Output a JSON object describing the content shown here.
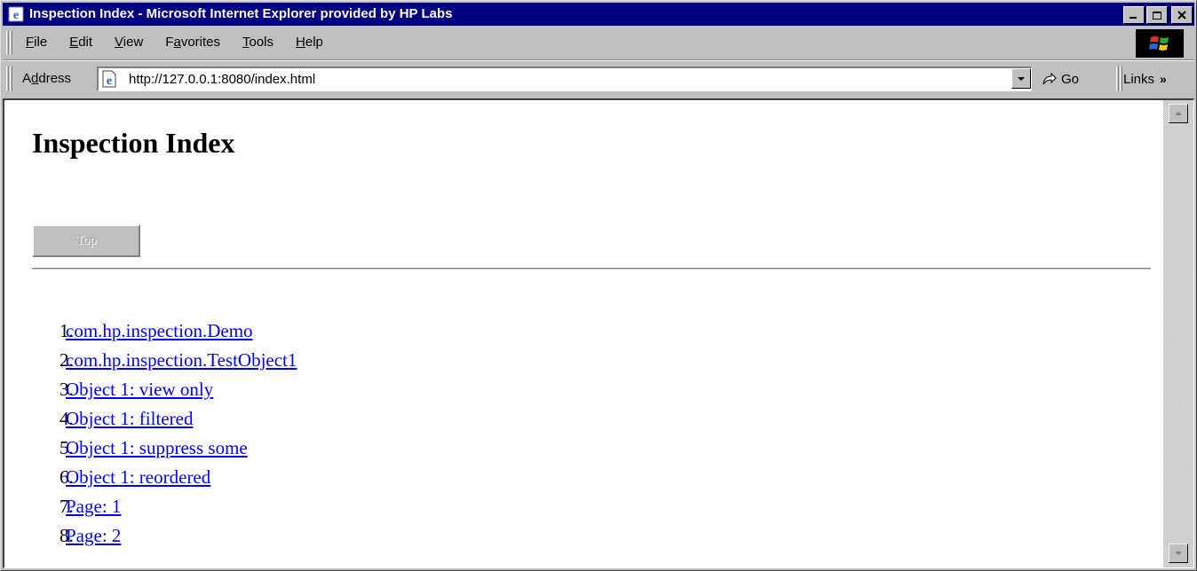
{
  "window": {
    "title": "Inspection Index - Microsoft Internet Explorer provided by HP Labs",
    "title_bar_color": "#000080"
  },
  "menubar": {
    "items": [
      {
        "prefix": "",
        "accel": "F",
        "rest": "ile"
      },
      {
        "prefix": "",
        "accel": "E",
        "rest": "dit"
      },
      {
        "prefix": "",
        "accel": "V",
        "rest": "iew"
      },
      {
        "prefix": "F",
        "accel": "a",
        "rest": "vorites"
      },
      {
        "prefix": "",
        "accel": "T",
        "rest": "ools"
      },
      {
        "prefix": "",
        "accel": "H",
        "rest": "elp"
      }
    ]
  },
  "addressbar": {
    "label_prefix": "A",
    "label_accel": "d",
    "label_rest": "dress",
    "url": "http://127.0.0.1:8080/index.html",
    "go_label": "Go",
    "links_label": "Links"
  },
  "page": {
    "heading": "Inspection Index",
    "top_button": "Top",
    "link_color": "#0000ff",
    "links": [
      {
        "num": "1.",
        "text": "com.hp.inspection.Demo"
      },
      {
        "num": "2.",
        "text": "com.hp.inspection.TestObject1"
      },
      {
        "num": "3.",
        "text": "Object 1: view only"
      },
      {
        "num": "4.",
        "text": "Object 1: filtered"
      },
      {
        "num": "5.",
        "text": "Object 1: suppress some"
      },
      {
        "num": "6.",
        "text": "Object 1: reordered"
      },
      {
        "num": "7.",
        "text": "Page: 1"
      },
      {
        "num": "8.",
        "text": "Page: 2"
      }
    ]
  },
  "icons": {
    "title": "ie-page-icon",
    "minimize": "minimize-icon",
    "maximize": "maximize-icon",
    "close": "close-icon",
    "throbber": "windows-logo-icon",
    "address_page": "ie-page-icon",
    "dropdown": "dropdown-arrow-icon",
    "go": "go-arrow-icon",
    "scroll_up": "scroll-up-icon",
    "scroll_down": "scroll-down-icon"
  }
}
